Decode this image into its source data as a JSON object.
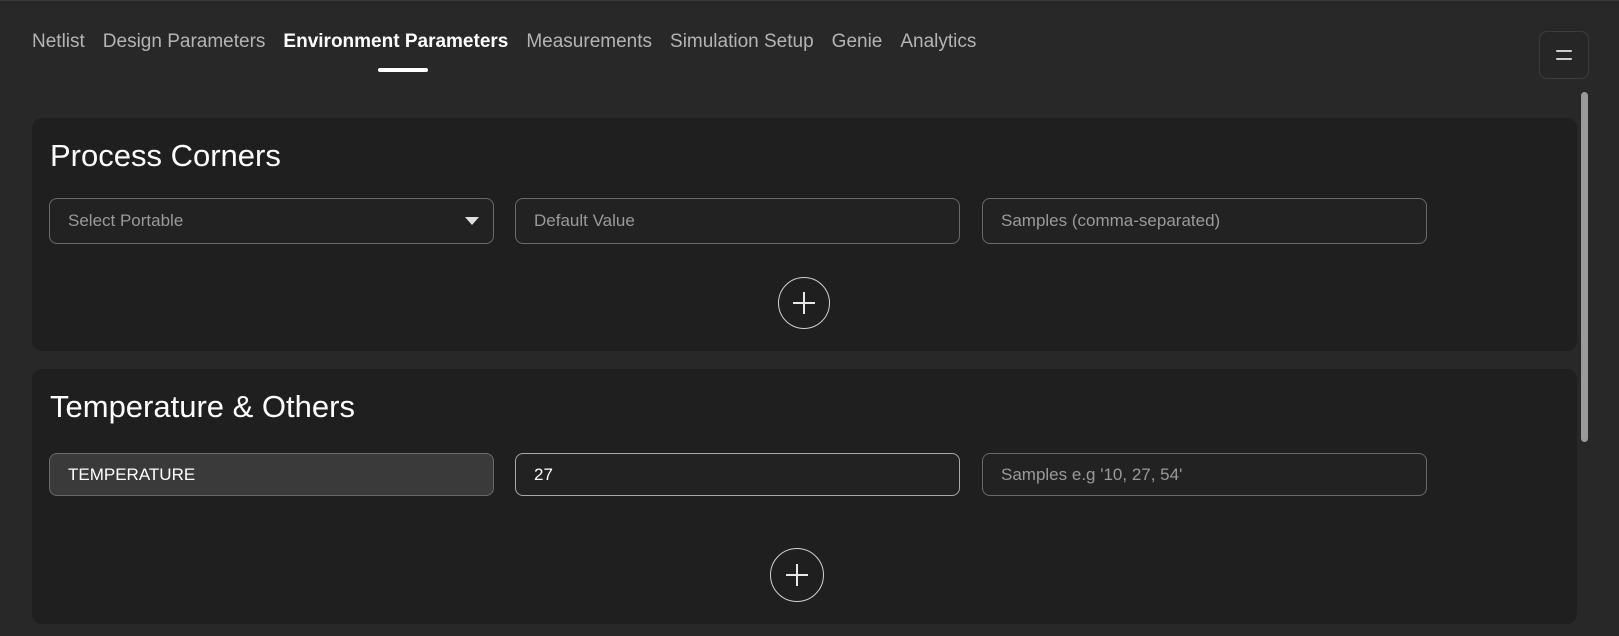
{
  "tabs": [
    {
      "label": "Netlist",
      "active": false
    },
    {
      "label": "Design Parameters",
      "active": false
    },
    {
      "label": "Environment Parameters",
      "active": true
    },
    {
      "label": "Measurements",
      "active": false
    },
    {
      "label": "Simulation Setup",
      "active": false
    },
    {
      "label": "Genie",
      "active": false
    },
    {
      "label": "Analytics",
      "active": false
    }
  ],
  "menu": {
    "icon": "menu-icon"
  },
  "process_corners": {
    "title": "Process Corners",
    "select": {
      "placeholder": "Select Portable",
      "icon": "chevron-down-icon"
    },
    "default_value": {
      "placeholder": "Default Value"
    },
    "samples": {
      "placeholder": "Samples (comma-separated)"
    },
    "add_icon": "plus-icon"
  },
  "temperature": {
    "title": "Temperature & Others",
    "name": {
      "value": "TEMPERATURE"
    },
    "default_value": {
      "value": "27"
    },
    "samples": {
      "placeholder": "Samples e.g '10, 27, 54'"
    },
    "add_icon": "plus-icon"
  },
  "colors": {
    "background": "#282828",
    "panel": "#1f1f1f",
    "active_tab": "#ffffff",
    "inactive_tab": "#b4b4b4"
  }
}
